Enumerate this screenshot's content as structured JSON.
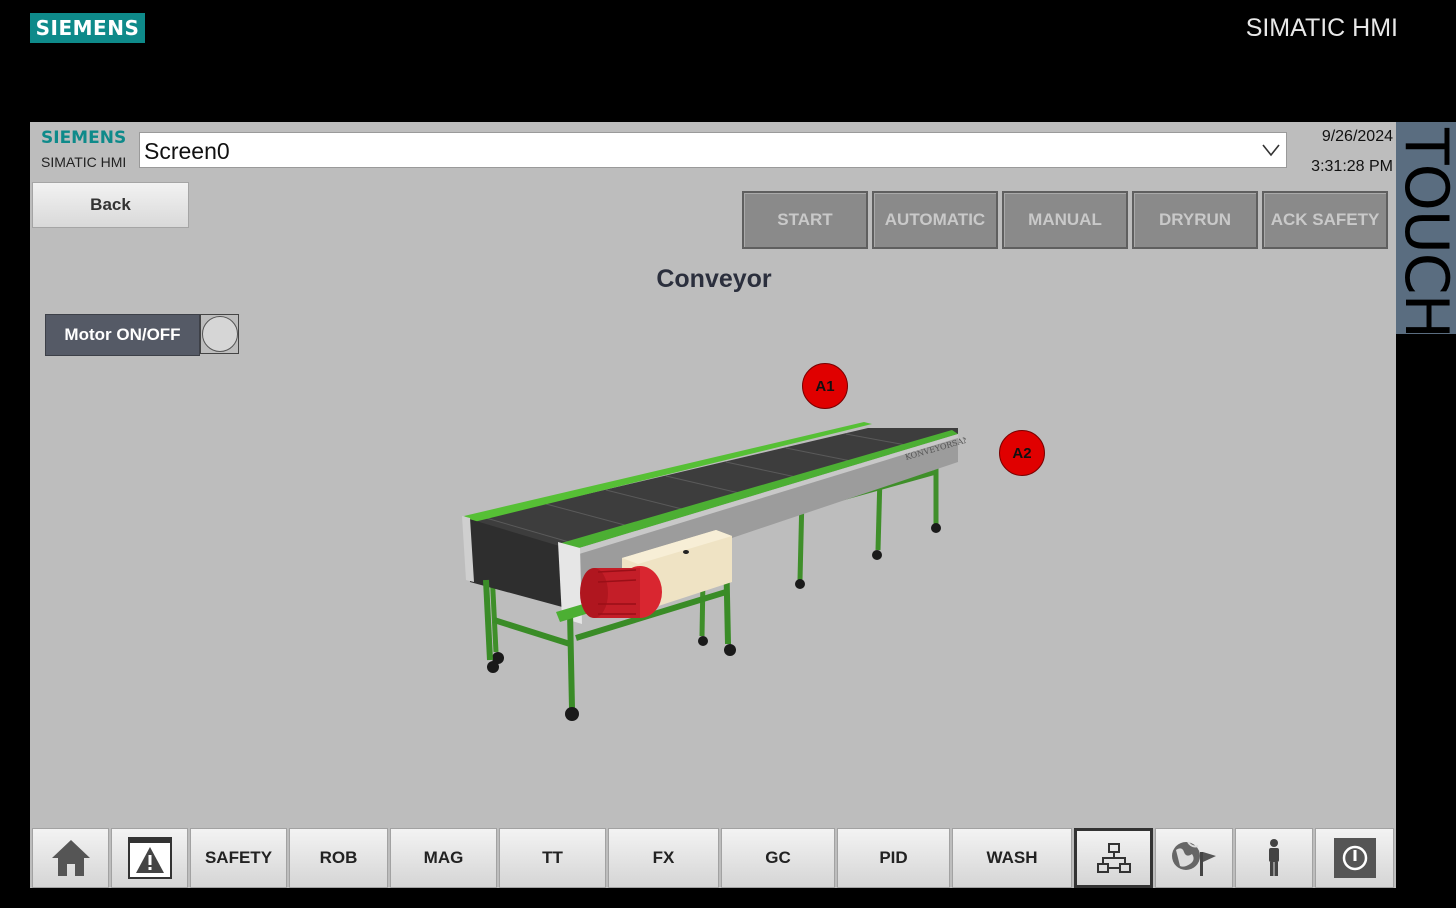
{
  "bezel": {
    "brand": "SIEMENS",
    "product": "SIMATIC HMI",
    "side_label": "TOUCH"
  },
  "header": {
    "brand": "SIEMENS",
    "product": "SIMATIC HMI",
    "screen_select": {
      "value": "Screen0"
    },
    "date": "9/26/2024",
    "time": "3:31:28 PM"
  },
  "back_label": "Back",
  "mode_buttons": [
    "START",
    "AUTOMATIC",
    "MANUAL",
    "DRYRUN",
    "ACK SAFETY"
  ],
  "page_title": "Conveyor",
  "motor": {
    "label": "Motor ON/OFF",
    "state": "off"
  },
  "sensors": [
    "A1",
    "A2"
  ],
  "conveyor_brand": "KONVEYORSAN",
  "nav": {
    "home_icon": "home-icon",
    "alarm_icon": "alarm-warning-icon",
    "items": [
      "SAFETY",
      "ROB",
      "MAG",
      "TT",
      "FX",
      "GC",
      "PID",
      "WASH"
    ],
    "overview_icon": "network-overview-icon",
    "language_icon": "globe-language-icon",
    "user_icon": "user-icon",
    "power_icon": "power-icon"
  },
  "colors": {
    "siemens_teal": "#0e8a8a",
    "screen_bg": "#bdbdbd",
    "sensor_active": "#e00000",
    "conveyor_frame": "#4caf33",
    "motor": "#d92630"
  }
}
